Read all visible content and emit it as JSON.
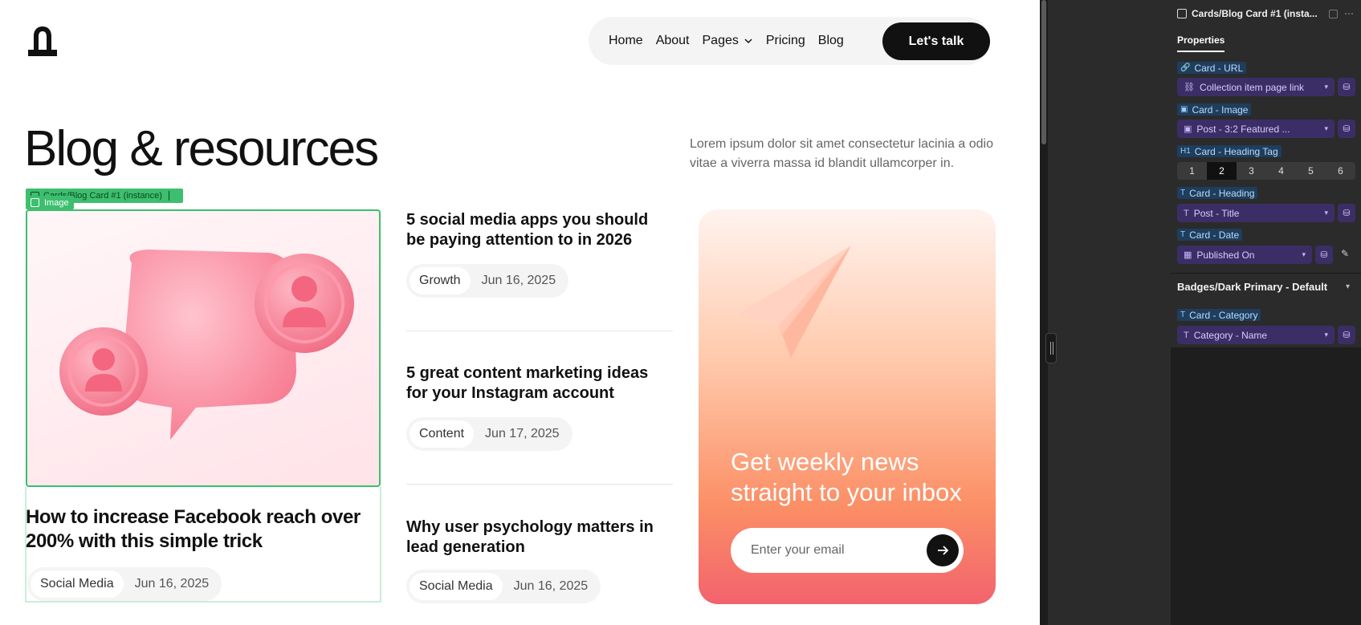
{
  "nav": {
    "items": [
      "Home",
      "About",
      "Pages",
      "Pricing",
      "Blog"
    ],
    "cta": "Let's talk"
  },
  "page": {
    "title": "Blog & resources",
    "intro": "Lorem ipsum dolor sit amet consectetur lacinia a odio vitae a viverra massa id blandit ullamcorper in."
  },
  "selection": {
    "component": "Cards/Blog Card #1 (instance)",
    "element": "Image"
  },
  "featured": {
    "title": "How to increase Facebook reach over 200% with this simple trick",
    "category": "Social Media",
    "date": "Jun 16, 2025"
  },
  "posts": [
    {
      "title": "5 social media apps you should be paying attention to in 2026",
      "category": "Growth",
      "date": "Jun 16, 2025"
    },
    {
      "title": "5 great content marketing ideas for your Instagram account",
      "category": "Content",
      "date": "Jun 17, 2025"
    },
    {
      "title": "Why user psychology matters in lead generation",
      "category": "Social Media",
      "date": "Jun 16, 2025"
    }
  ],
  "newsletter": {
    "heading": "Get weekly news straight to your inbox",
    "placeholder": "Enter your email"
  },
  "panel": {
    "title": "Cards/Blog Card #1 (insta...",
    "tab": "Properties",
    "card_url_label": "Card - URL",
    "card_url_value": "Collection item page link",
    "card_image_label": "Card - Image",
    "card_image_value": "Post - 3:2 Featured ...",
    "heading_tag_label": "Card - Heading Tag",
    "heading_tags": [
      "1",
      "2",
      "3",
      "4",
      "5",
      "6"
    ],
    "heading_tag_selected": "2",
    "card_heading_label": "Card - Heading",
    "card_heading_value": "Post - Title",
    "card_date_label": "Card - Date",
    "card_date_value": "Published On",
    "badges_section": "Badges/Dark Primary - Default",
    "card_category_label": "Card - Category",
    "card_category_value": "Category - Name"
  },
  "colors": {
    "accent_green": "#3cbf6e",
    "panel_purple": "#3b2e66",
    "label_blue": "#1f3d5c",
    "newsletter_top": "#fff3ef",
    "newsletter_bottom": "#f2636d"
  }
}
